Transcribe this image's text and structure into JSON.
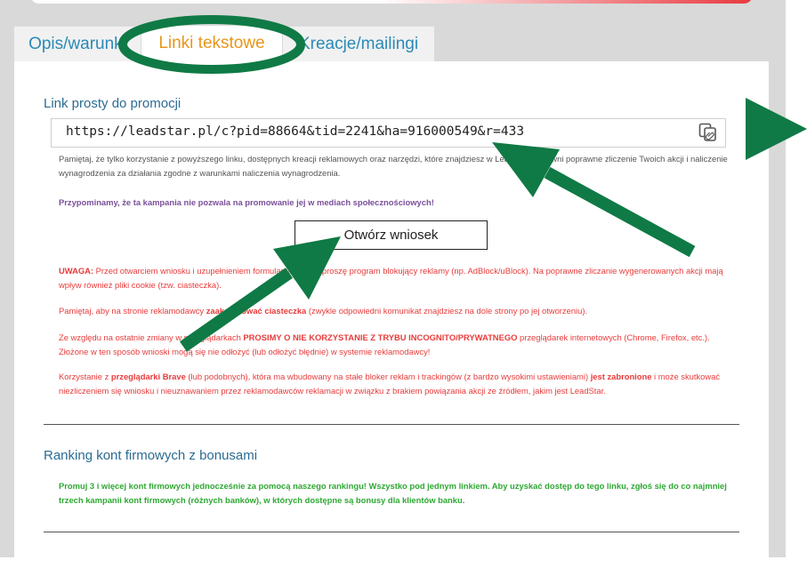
{
  "tabs": [
    {
      "label": "Opis/warunki",
      "active": false
    },
    {
      "label": "Linki tekstowe",
      "active": true
    },
    {
      "label": "Kreacje/mailingi",
      "active": false
    }
  ],
  "link_section": {
    "title": "Link prosty do promocji",
    "url": "https://leadstar.pl/c?pid=88664&tid=2241&ha=916000549&r=433",
    "copy_icon": "copy-icon",
    "notice": "Pamiętaj, że tylko korzystanie z powyższego linku, dostępnych kreacji reklamowych oraz narzędzi, które znajdziesz w LeadStar, zapewni poprawne zliczenie Twoich akcji i naliczenie wynagrodzenia za działania zgodne z warunkami naliczenia wynagrodzenia.",
    "social_notice": "Przypominamy, że ta kampania nie pozwala na promowanie jej w mediach społecznościowych!",
    "open_button": "Otwórz wniosek",
    "warning1_prefix": "UWAGA:",
    "warning1_text": " Przed otwarciem wniosku i uzupełnieniem formularza wyłącz proszę program blokujący reklamy (np. AdBlock/uBlock). Na poprawne zliczanie wygenerowanych akcji mają wpływ również pliki cookie (tzw. ciasteczka).",
    "warning2_a": "Pamiętaj, aby na stronie reklamodawcy ",
    "warning2_b": "zaakceptować ciasteczka",
    "warning2_c": " (zwykle odpowiedni komunikat znajdziesz na dole strony po jej otworzeniu).",
    "warning3_a": "Ze względu na ostatnie zmiany w przeglądarkach ",
    "warning3_b": "PROSIMY O NIE KORZYSTANIE Z TRYBU INCOGNITO/PRYWATNEGO",
    "warning3_c": " przeglądarek internetowych (Chrome, Firefox, etc.). Złożone w ten sposób wnioski mogą się nie odłożyć (lub odłożyć błędnie) w systemie reklamodawcy!",
    "warning4_a": "Korzystanie z ",
    "warning4_b": "przeglądarki Brave",
    "warning4_c": " (lub podobnych), która ma wbudowany na stałe bloker reklam i trackingów (z bardzo wysokimi ustawieniami) ",
    "warning4_d": "jest zabronione",
    "warning4_e": " i może skutkować niezliczeniem się wniosku i nieuznawaniem przez reklamodawców reklamacji w związku z brakiem powiązania akcji ze źródłem, jakim jest LeadStar."
  },
  "ranking_section": {
    "title": "Ranking kont firmowych z bonusami",
    "text": "Promuj 3 i więcej kont firmowych jednocześnie za pomocą naszego rankingu! Wszystko pod jednym linkiem. Aby uzyskać dostęp do tego linku, zgłoś się do co najmniej trzech kampanii kont firmowych (różnych banków), w których dostępne są bonusy dla klientów banku."
  },
  "colors": {
    "annotation_green": "#0f7a45",
    "tab_active": "#e7961b",
    "tab_inactive": "#2a8ab6",
    "section_title": "#2b6c93",
    "warning_red": "#e83b3b",
    "promo_green": "#2ea833",
    "social_purple": "#7a4f9a"
  }
}
